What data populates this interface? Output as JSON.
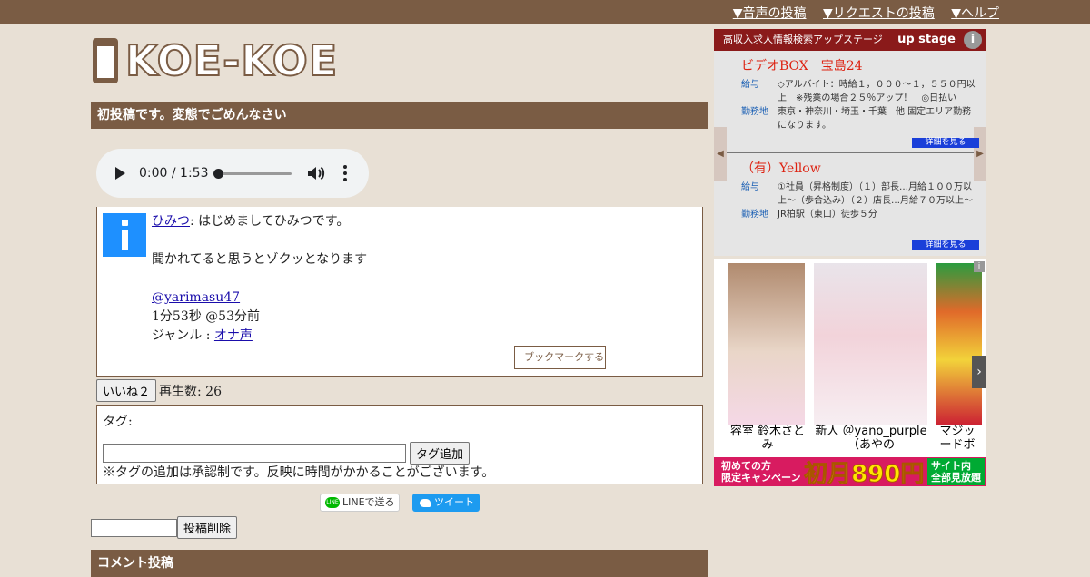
{
  "nav": {
    "items": [
      "▼音声の投稿",
      "▼リクエストの投稿",
      "▼ヘルプ"
    ]
  },
  "logo": {
    "text": "KOE-KOE"
  },
  "post": {
    "title": "初投稿です。変態でごめんなさい",
    "player": {
      "time": "0:00 / 1:53",
      "progress": 0
    },
    "author": "ひみつ",
    "message": ": はじめましてひみつです。",
    "body": "聞かれてると思うとゾクッとなります",
    "handle": "@yarimasu47",
    "meta": "1分53秒 @53分前",
    "genre_label": "ジャンル : ",
    "genre": "オナ声",
    "bookmark_label": "+ブックマークする"
  },
  "likes": {
    "button": "いいね２",
    "plays": "再生数: 26"
  },
  "tags": {
    "label": "タグ:",
    "input_value": "",
    "add_button": "タグ追加",
    "note": "※タグの追加は承認制です。反映に時間がかかることがございます。"
  },
  "share": {
    "line": "LINEで送る",
    "tweet": "ツイート",
    "line_icon": "LINE"
  },
  "delete": {
    "input_value": "",
    "button": "投稿削除"
  },
  "comment": {
    "title": "コメント投稿"
  },
  "ad_jobs": {
    "header": "高収入求人情報検索アップステージ",
    "brand": "up stage",
    "info": "i",
    "jobs": [
      {
        "name": "ビデオBOX　宝島24",
        "pay_label": "給与",
        "pay": "◇アルバイト：時給１，０００～１，５５０円以上　※残業の場合２５％アップ！　◎日払い",
        "loc_label": "勤務地",
        "loc": "東京・神奈川・埼玉・千葉　他 固定エリア勤務になります。",
        "detail": "詳細を見る"
      },
      {
        "name": "（有）Yellow",
        "pay_label": "給与",
        "pay": "①社員（昇格制度）（１）部長…月給１００万以上～（歩合込み）（２）店長…月給７０万以上～",
        "loc_label": "勤務地",
        "loc": "JR柏駅（東口）徒歩５分",
        "detail": "詳細を見る"
      }
    ]
  },
  "ad_videos": {
    "items": [
      "容室 鈴木さとみ",
      "新人 ＠yano_purple（あやの",
      "マジッードボ"
    ],
    "banner_left": "初めての方\n限定キャンペーン",
    "banner_price": "初月890円",
    "banner_right": "サイト内\n全部見放題"
  },
  "colors": {
    "brand": "#7a5c44",
    "link": "#1a0dab",
    "background": "#e8e0d5"
  }
}
